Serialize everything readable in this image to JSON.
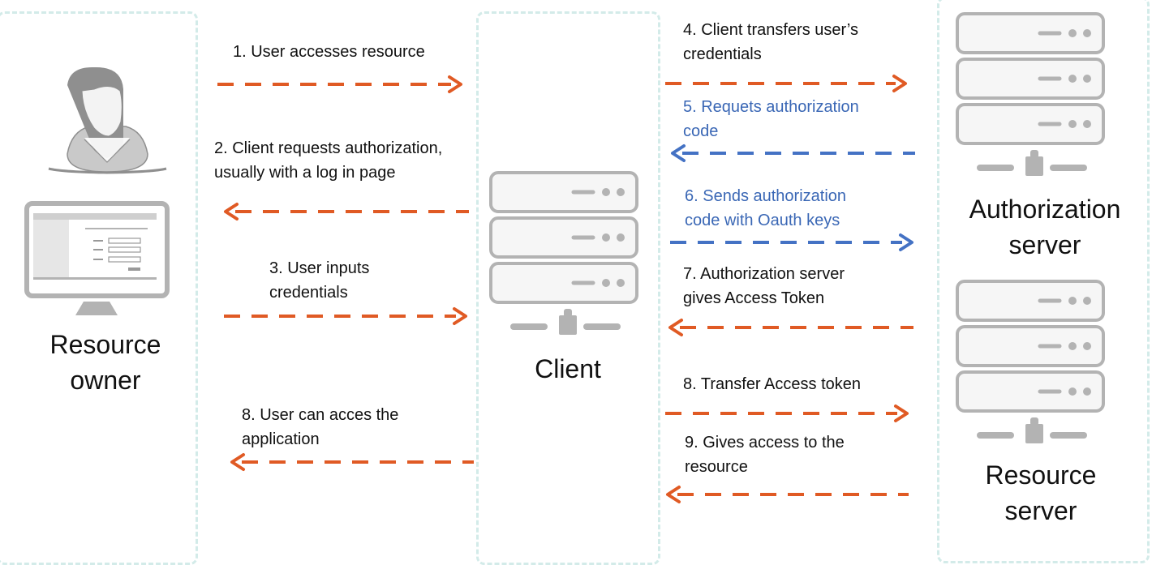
{
  "colors": {
    "orange_arrow": "#e05a24",
    "blue_arrow": "#4472c4",
    "blue_text": "#3a67b5",
    "lane_border": "#d3ebe9",
    "icon_gray": "#b3b3b3"
  },
  "actors": {
    "resource_owner": {
      "label": "Resource\nowner",
      "icons": [
        "user-avatar-icon",
        "monitor-login-icon"
      ]
    },
    "client": {
      "label": "Client",
      "icons": [
        "server-icon"
      ]
    },
    "authorization_server": {
      "label": "Authorization\nserver",
      "icons": [
        "server-icon"
      ]
    },
    "resource_server": {
      "label": "Resource\nserver",
      "icons": [
        "server-icon"
      ]
    }
  },
  "steps": [
    {
      "id": "s1",
      "text": "1. User accesses resource",
      "direction": "right",
      "color": "orange",
      "from": "resource_owner",
      "to": "client"
    },
    {
      "id": "s2",
      "text": "2. Client requests authorization,\nusually with a log in page",
      "direction": "left",
      "color": "orange",
      "from": "client",
      "to": "resource_owner"
    },
    {
      "id": "s3",
      "text": "3. User inputs\ncredentials",
      "direction": "right",
      "color": "orange",
      "from": "resource_owner",
      "to": "client"
    },
    {
      "id": "s8a",
      "text": "8. User can acces the\napplication",
      "direction": "left",
      "color": "orange",
      "from": "client",
      "to": "resource_owner"
    },
    {
      "id": "s4",
      "text": "4. Client transfers user’s\ncredentials",
      "direction": "right",
      "color": "orange",
      "from": "client",
      "to": "authorization_server"
    },
    {
      "id": "s5",
      "text": "5. Requets authorization\ncode",
      "direction": "left",
      "color": "blue",
      "from": "authorization_server",
      "to": "client"
    },
    {
      "id": "s6",
      "text": "6. Sends authorization\ncode with Oauth keys",
      "direction": "right",
      "color": "blue",
      "from": "client",
      "to": "authorization_server"
    },
    {
      "id": "s7",
      "text": "7. Authorization server\ngives Access Token",
      "direction": "left",
      "color": "orange",
      "from": "authorization_server",
      "to": "client"
    },
    {
      "id": "s8b",
      "text": "8. Transfer Access token",
      "direction": "right",
      "color": "orange",
      "from": "client",
      "to": "resource_server"
    },
    {
      "id": "s9",
      "text": "9. Gives access to the\nresource",
      "direction": "left",
      "color": "orange",
      "from": "resource_server",
      "to": "client"
    }
  ]
}
